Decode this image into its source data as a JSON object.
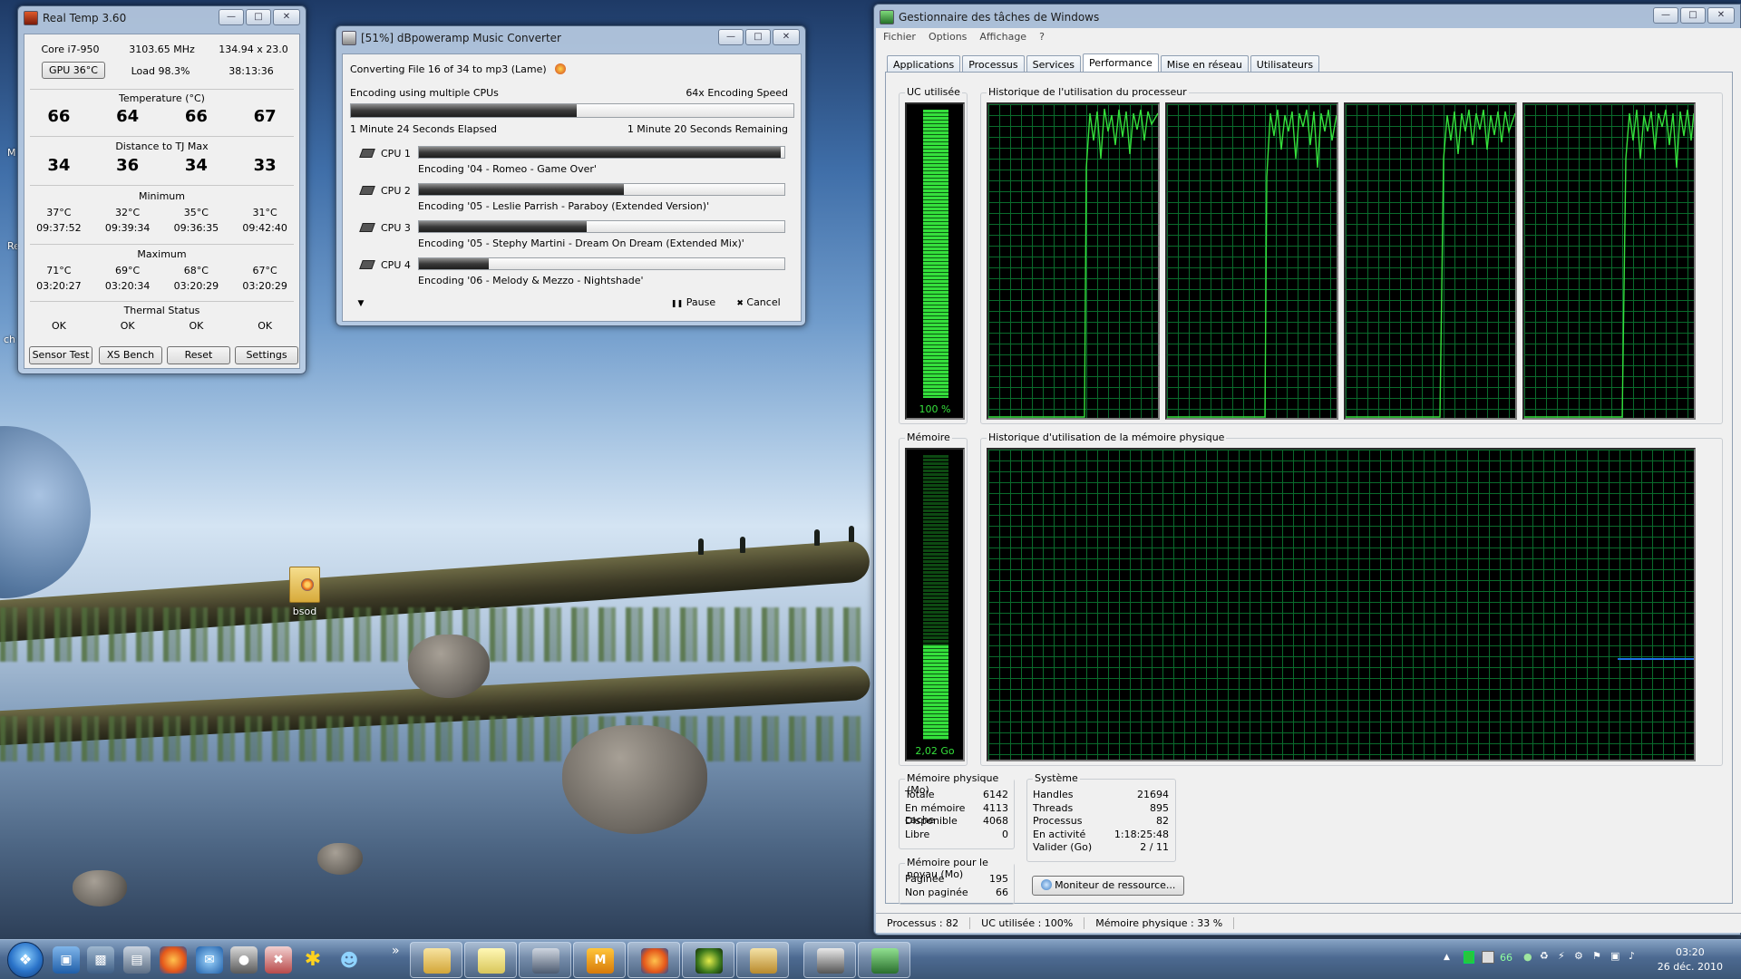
{
  "desktop": {
    "icon_label": "bsod",
    "edge_texts": [
      "M",
      "Re",
      "ch"
    ]
  },
  "realtemp": {
    "title": "Real Temp 3.60",
    "cpu_model": "Core i7-950",
    "freq": "3103.65 MHz",
    "multiplier": "134.94 x 23.0",
    "gpu_button": "GPU 36°C",
    "load": "Load 98.3%",
    "uptime": "38:13:36",
    "temp_caption": "Temperature (°C)",
    "temps": [
      "66",
      "64",
      "66",
      "67"
    ],
    "tjmax_caption": "Distance to TJ Max",
    "tjmax": [
      "34",
      "36",
      "34",
      "33"
    ],
    "min_caption": "Minimum",
    "min_temps": [
      "37°C",
      "32°C",
      "35°C",
      "31°C"
    ],
    "min_times": [
      "09:37:52",
      "09:39:34",
      "09:36:35",
      "09:42:40"
    ],
    "max_caption": "Maximum",
    "max_temps": [
      "71°C",
      "69°C",
      "68°C",
      "67°C"
    ],
    "max_times": [
      "03:20:27",
      "03:20:34",
      "03:20:29",
      "03:20:29"
    ],
    "thermal_caption": "Thermal Status",
    "thermal": [
      "OK",
      "OK",
      "OK",
      "OK"
    ],
    "buttons": {
      "sensor_test": "Sensor Test",
      "xs_bench": "XS Bench",
      "reset": "Reset",
      "settings": "Settings"
    }
  },
  "dbpa": {
    "title": "[51%] dBpoweramp Music Converter",
    "converting": "Converting File 16 of 34 to mp3 (Lame)",
    "mode": "Encoding using multiple CPUs",
    "speed": "64x Encoding Speed",
    "overall_progress": 0.51,
    "elapsed": "1 Minute 24 Seconds Elapsed",
    "remaining": "1 Minute 20 Seconds Remaining",
    "cpus": [
      {
        "label": "CPU 1",
        "file": "Encoding '04 - Romeo - Game Over'",
        "progress": 0.99
      },
      {
        "label": "CPU 2",
        "file": "Encoding '05 - Leslie Parrish - Paraboy (Extended Version)'",
        "progress": 0.56
      },
      {
        "label": "CPU 3",
        "file": "Encoding '05 - Stephy Martini - Dream On Dream (Extended Mix)'",
        "progress": 0.46
      },
      {
        "label": "CPU 4",
        "file": "Encoding '06 - Melody & Mezzo - Nightshade'",
        "progress": 0.19
      }
    ],
    "pause": "Pause",
    "cancel": "Cancel",
    "pause_icon": "pause-icon",
    "cancel_icon": "close-icon"
  },
  "taskmgr": {
    "title": "Gestionnaire des tâches de Windows",
    "menu": [
      "Fichier",
      "Options",
      "Affichage",
      "?"
    ],
    "tabs": [
      "Applications",
      "Processus",
      "Services",
      "Performance",
      "Mise en réseau",
      "Utilisateurs"
    ],
    "active_tab": "Performance",
    "cpu_usage_label": "UC utilisée",
    "cpu_usage_value": "100 %",
    "cpu_usage_level": 1.0,
    "cpu_history_label": "Historique de l'utilisation du processeur",
    "memory_label": "Mémoire",
    "memory_value": "2,02 Go",
    "memory_level": 0.33,
    "memory_history_label": "Historique d'utilisation de la mémoire physique",
    "physical": {
      "title": "Mémoire physique (Mo)",
      "rows": [
        [
          "Totale",
          "6142"
        ],
        [
          "En mémoire cache",
          "4113"
        ],
        [
          "Disponible",
          "4068"
        ],
        [
          "Libre",
          "0"
        ]
      ]
    },
    "kernel": {
      "title": "Mémoire pour le noyau (Mo)",
      "rows": [
        [
          "Paginée",
          "195"
        ],
        [
          "Non paginée",
          "66"
        ]
      ]
    },
    "system": {
      "title": "Système",
      "rows": [
        [
          "Handles",
          "21694"
        ],
        [
          "Threads",
          "895"
        ],
        [
          "Processus",
          "82"
        ],
        [
          "En activité",
          "1:18:25:48"
        ],
        [
          "Valider (Go)",
          "2 / 11"
        ]
      ]
    },
    "resource_button": "Moniteur de ressource...",
    "status": [
      "Processus : 82",
      "UC utilisée : 100%",
      "Mémoire physique : 33 %"
    ]
  },
  "taskbar": {
    "tray_temp": "66",
    "clock_time": "03:20",
    "clock_date": "26 déc. 2010",
    "overflow": "»"
  },
  "colors": {
    "graph_green": "#35e03c",
    "grid_green": "#0a6b2c",
    "memory_blue": "#1e6ee8",
    "accent_blue": "#4a6fa5"
  }
}
